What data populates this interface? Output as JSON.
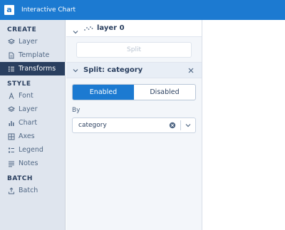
{
  "app": {
    "logo_letter": "a",
    "title": "Interactive Chart"
  },
  "sidebar": {
    "sections": [
      {
        "title": "CREATE"
      },
      {
        "title": "STYLE"
      },
      {
        "title": "BATCH"
      }
    ],
    "items": [
      {
        "label": "Layer",
        "icon": "layers-icon"
      },
      {
        "label": "Template",
        "icon": "file-icon"
      },
      {
        "label": "Transforms",
        "icon": "list-icon",
        "active": true
      },
      {
        "label": "Font",
        "icon": "font-icon"
      },
      {
        "label": "Layer",
        "icon": "layers-icon"
      },
      {
        "label": "Chart",
        "icon": "bar-chart-icon"
      },
      {
        "label": "Axes",
        "icon": "grid-icon"
      },
      {
        "label": "Legend",
        "icon": "legend-icon"
      },
      {
        "label": "Notes",
        "icon": "notes-icon"
      },
      {
        "label": "Batch",
        "icon": "upload-icon"
      }
    ]
  },
  "panel": {
    "layer_header": "layer 0",
    "split_button": "Split",
    "group_title": "Split: category",
    "toggle": {
      "enabled": "Enabled",
      "disabled": "Disabled",
      "selected": "Enabled"
    },
    "by_label": "By",
    "by_value": "category"
  },
  "colors": {
    "accent": "#1c7ad1",
    "sidebar_active": "#2a3f5f",
    "sidebar_bg": "#dfe5ee"
  }
}
